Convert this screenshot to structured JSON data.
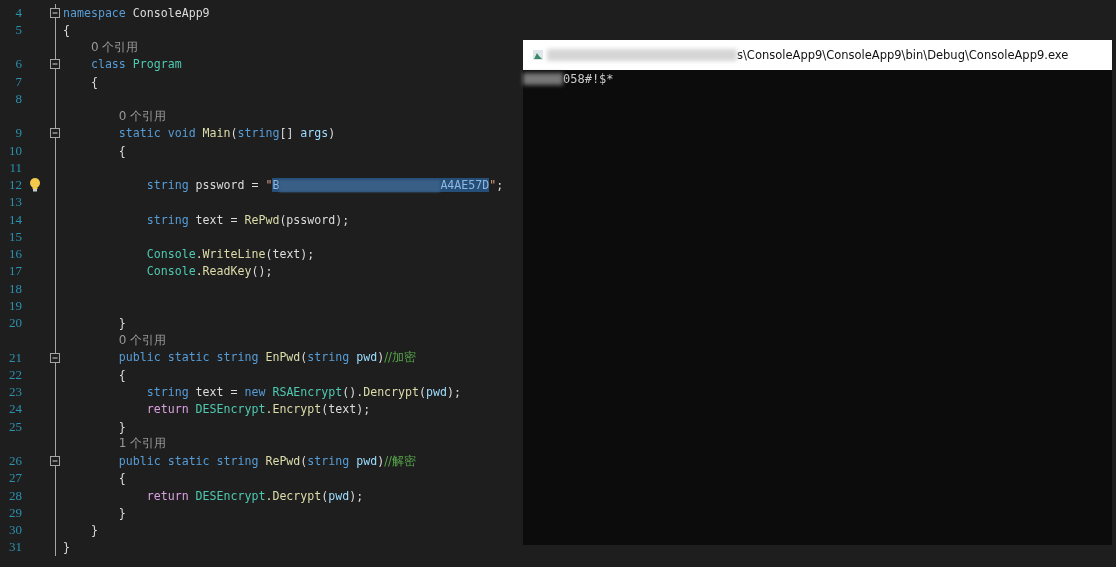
{
  "editor": {
    "rows": [
      {
        "kind": "code",
        "line": "4",
        "fold": true,
        "tokens": [
          {
            "kind": "keyword",
            "text": "namespace"
          },
          {
            "kind": "plain",
            "text": " ConsoleApp9"
          }
        ]
      },
      {
        "kind": "code",
        "line": "5",
        "tokens": [
          {
            "kind": "plain",
            "text": "{"
          }
        ]
      },
      {
        "kind": "lens",
        "indent": "    ",
        "text": "0 个引用"
      },
      {
        "kind": "code",
        "line": "6",
        "fold": true,
        "tokens": [
          {
            "kind": "keyword",
            "text": "    class"
          },
          {
            "kind": "type",
            "text": " Program"
          }
        ]
      },
      {
        "kind": "code",
        "line": "7",
        "tokens": [
          {
            "kind": "plain",
            "text": "    {"
          }
        ]
      },
      {
        "kind": "code",
        "line": "8",
        "tokens": []
      },
      {
        "kind": "lens",
        "indent": "        ",
        "text": "0 个引用"
      },
      {
        "kind": "code",
        "line": "9",
        "fold": true,
        "tokens": [
          {
            "kind": "keyword",
            "text": "        static void"
          },
          {
            "kind": "method",
            "text": " Main"
          },
          {
            "kind": "plain",
            "text": "("
          },
          {
            "kind": "keyword",
            "text": "string"
          },
          {
            "kind": "plain",
            "text": "[] "
          },
          {
            "kind": "param",
            "text": "args"
          },
          {
            "kind": "plain",
            "text": ")"
          }
        ]
      },
      {
        "kind": "code",
        "line": "10",
        "tokens": [
          {
            "kind": "plain",
            "text": "        {"
          }
        ]
      },
      {
        "kind": "code",
        "line": "11",
        "tokens": []
      },
      {
        "kind": "code",
        "line": "12",
        "lightbulb": true,
        "tokens": [
          {
            "kind": "keyword",
            "text": "            string"
          },
          {
            "kind": "plain",
            "text": " pssword = "
          },
          {
            "kind": "string",
            "text": "\""
          },
          {
            "kind": "selection",
            "parts": [
              {
                "kind": "string",
                "text": "B"
              },
              {
                "kind": "redacted"
              },
              {
                "kind": "string",
                "text": "A4AE57D"
              }
            ]
          },
          {
            "kind": "string",
            "text": "\""
          },
          {
            "kind": "plain",
            "text": ";"
          }
        ]
      },
      {
        "kind": "code",
        "line": "13",
        "tokens": []
      },
      {
        "kind": "code",
        "line": "14",
        "tokens": [
          {
            "kind": "keyword",
            "text": "            string"
          },
          {
            "kind": "plain",
            "text": " text = "
          },
          {
            "kind": "method",
            "text": "RePwd"
          },
          {
            "kind": "plain",
            "text": "(pssword);"
          }
        ]
      },
      {
        "kind": "code",
        "line": "15",
        "tokens": []
      },
      {
        "kind": "code",
        "line": "16",
        "tokens": [
          {
            "kind": "type",
            "text": "            Console"
          },
          {
            "kind": "method",
            "text": ".WriteLine"
          },
          {
            "kind": "plain",
            "text": "(text);"
          }
        ]
      },
      {
        "kind": "code",
        "line": "17",
        "tokens": [
          {
            "kind": "type",
            "text": "            Console"
          },
          {
            "kind": "method",
            "text": ".ReadKey"
          },
          {
            "kind": "plain",
            "text": "();"
          }
        ]
      },
      {
        "kind": "code",
        "line": "18",
        "tokens": []
      },
      {
        "kind": "code",
        "line": "19",
        "tokens": []
      },
      {
        "kind": "code",
        "line": "20",
        "tokens": [
          {
            "kind": "plain",
            "text": "        }"
          }
        ]
      },
      {
        "kind": "lens",
        "indent": "        ",
        "text": "0 个引用"
      },
      {
        "kind": "code",
        "line": "21",
        "fold": true,
        "tokens": [
          {
            "kind": "keyword",
            "text": "        public static string"
          },
          {
            "kind": "method",
            "text": " EnPwd"
          },
          {
            "kind": "plain",
            "text": "("
          },
          {
            "kind": "keyword",
            "text": "string"
          },
          {
            "kind": "param",
            "text": " pwd"
          },
          {
            "kind": "plain",
            "text": ")"
          },
          {
            "kind": "comment",
            "text": "//加密"
          }
        ]
      },
      {
        "kind": "code",
        "line": "22",
        "tokens": [
          {
            "kind": "plain",
            "text": "        {"
          }
        ]
      },
      {
        "kind": "code",
        "line": "23",
        "tokens": [
          {
            "kind": "keyword",
            "text": "            string"
          },
          {
            "kind": "plain",
            "text": " text = "
          },
          {
            "kind": "keyword",
            "text": "new"
          },
          {
            "kind": "type",
            "text": " RSAEncrypt"
          },
          {
            "kind": "plain",
            "text": "()."
          },
          {
            "kind": "method",
            "text": "Dencrypt"
          },
          {
            "kind": "plain",
            "text": "("
          },
          {
            "kind": "param",
            "text": "pwd"
          },
          {
            "kind": "plain",
            "text": ");"
          }
        ]
      },
      {
        "kind": "code",
        "line": "24",
        "tokens": [
          {
            "kind": "control",
            "text": "            return"
          },
          {
            "kind": "type",
            "text": " DESEncrypt"
          },
          {
            "kind": "method",
            "text": ".Encrypt"
          },
          {
            "kind": "plain",
            "text": "(text);"
          }
        ]
      },
      {
        "kind": "code",
        "line": "25",
        "tokens": [
          {
            "kind": "plain",
            "text": "        }"
          }
        ]
      },
      {
        "kind": "lens",
        "indent": "        ",
        "text": "1 个引用"
      },
      {
        "kind": "code",
        "line": "26",
        "fold": true,
        "tokens": [
          {
            "kind": "keyword",
            "text": "        public static string"
          },
          {
            "kind": "method",
            "text": " RePwd"
          },
          {
            "kind": "plain",
            "text": "("
          },
          {
            "kind": "keyword",
            "text": "string"
          },
          {
            "kind": "param",
            "text": " pwd"
          },
          {
            "kind": "plain",
            "text": ")"
          },
          {
            "kind": "comment",
            "text": "//解密"
          }
        ]
      },
      {
        "kind": "code",
        "line": "27",
        "tokens": [
          {
            "kind": "plain",
            "text": "        {"
          }
        ]
      },
      {
        "kind": "code",
        "line": "28",
        "tokens": [
          {
            "kind": "control",
            "text": "            return"
          },
          {
            "kind": "type",
            "text": " DESEncrypt"
          },
          {
            "kind": "method",
            "text": ".Decrypt"
          },
          {
            "kind": "plain",
            "text": "("
          },
          {
            "kind": "param",
            "text": "pwd"
          },
          {
            "kind": "plain",
            "text": ");"
          }
        ]
      },
      {
        "kind": "code",
        "line": "29",
        "tokens": [
          {
            "kind": "plain",
            "text": "        }"
          }
        ]
      },
      {
        "kind": "code",
        "line": "30",
        "tokens": [
          {
            "kind": "plain",
            "text": "    }"
          }
        ]
      },
      {
        "kind": "code",
        "line": "31",
        "tokens": [
          {
            "kind": "plain",
            "text": "}"
          }
        ]
      }
    ]
  },
  "console": {
    "title": "s\\ConsoleApp9\\ConsoleApp9\\bin\\Debug\\ConsoleApp9.exe",
    "output": "058#!$*"
  }
}
